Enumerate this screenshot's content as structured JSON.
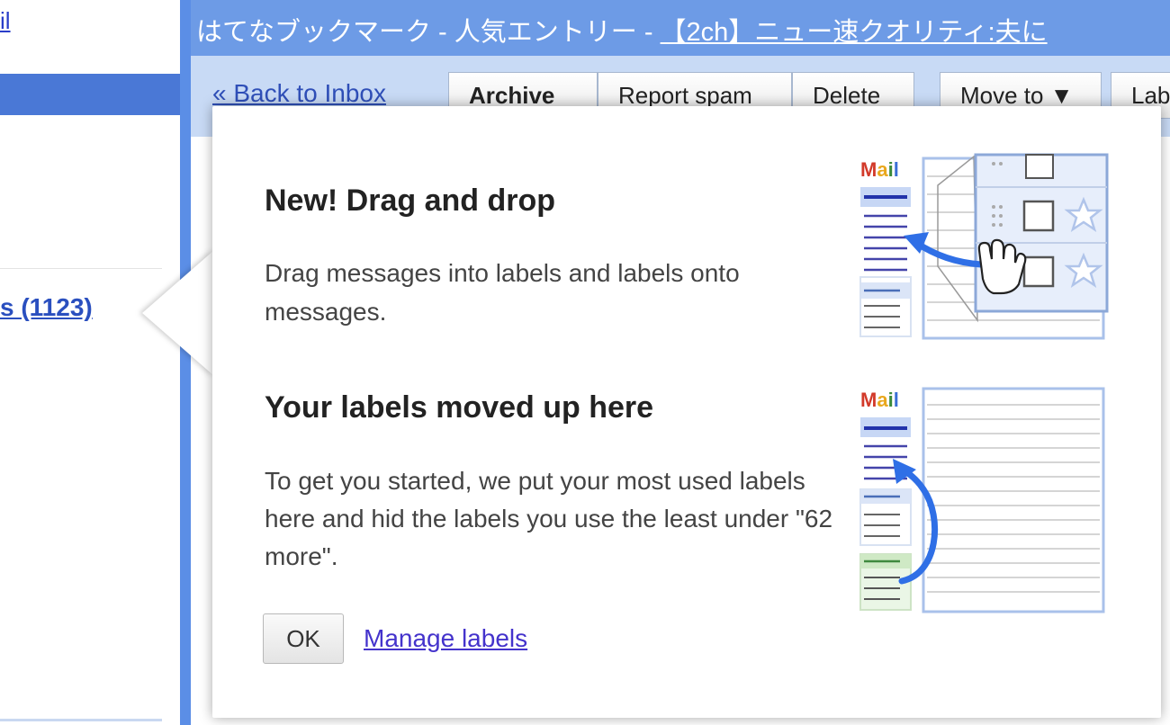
{
  "sidebar": {
    "top_link": "il",
    "count_link": "s (1123)"
  },
  "subject": {
    "prefix": "はてなブックマーク - 人気エントリー - ",
    "link": "【2ch】ニュー速クオリティ:夫に"
  },
  "toolbar": {
    "back": "« Back to Inbox",
    "archive": "Archive",
    "report_spam": "Report spam",
    "delete": "Delete",
    "move_to": "Move to ▼",
    "labels": "Lab"
  },
  "popup": {
    "heading1": "New! Drag and drop",
    "text1": "Drag messages into labels and labels onto messages.",
    "heading2": "Your labels moved up here",
    "text2": "To get you started, we put your most used labels here and hid the labels you use the least under \"62 more\".",
    "ok": "OK",
    "manage": "Manage labels"
  },
  "illustration": {
    "logo": "Mail"
  },
  "colors": {
    "gmail_blue": "#6d9be6",
    "toolbar_bg": "#c8daf5",
    "link": "#2a4fbf",
    "arrow": "#2f6fe6"
  }
}
